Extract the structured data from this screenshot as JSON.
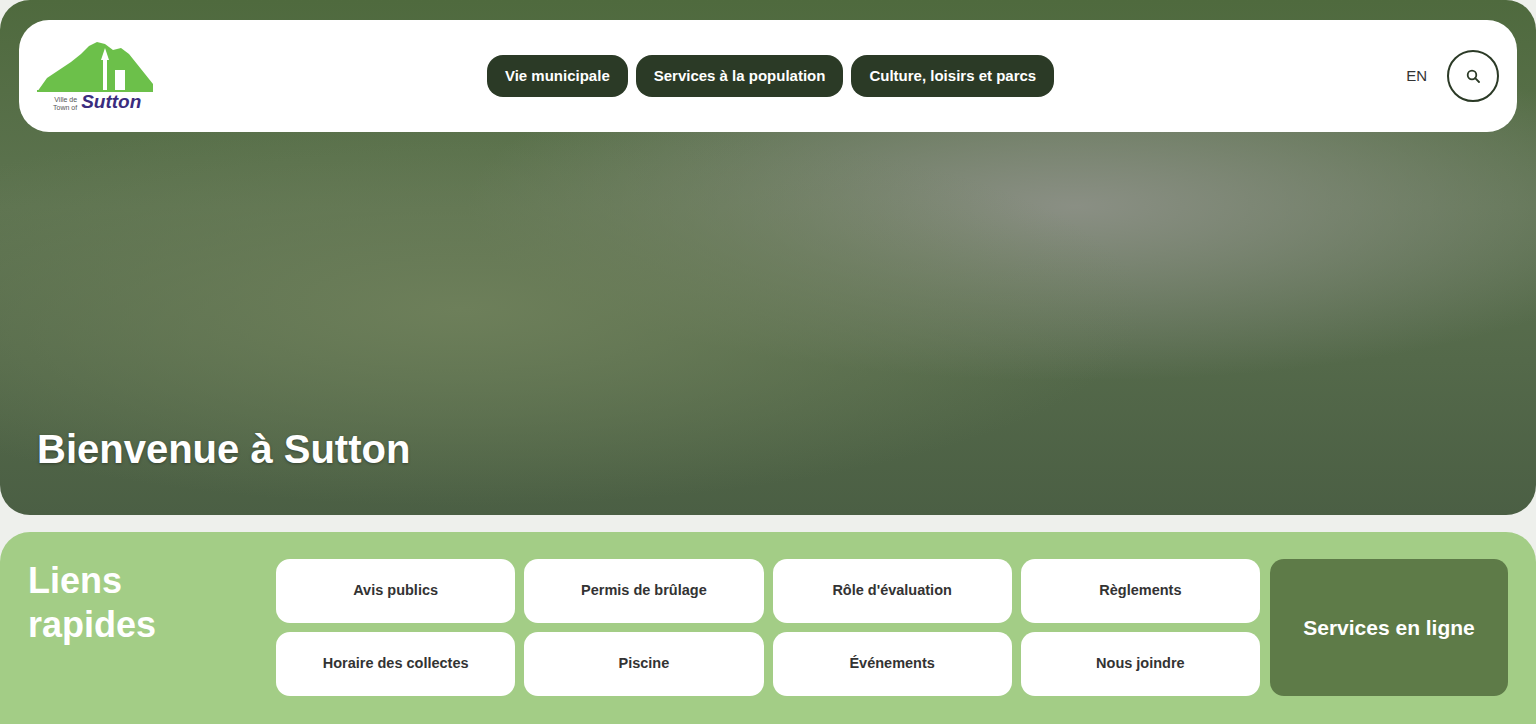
{
  "header": {
    "logo": {
      "line1": "Ville de",
      "line2": "Town of",
      "name": "Sutton"
    },
    "nav": [
      "Vie municipale",
      "Services à la population",
      "Culture, loisirs et parcs"
    ],
    "language": "EN"
  },
  "hero": {
    "title": "Bienvenue à Sutton"
  },
  "quick_links": {
    "title": "Liens rapides",
    "links": [
      "Avis publics",
      "Permis de brûlage",
      "Rôle d'évaluation",
      "Règlements",
      "Horaire des collectes",
      "Piscine",
      "Événements",
      "Nous joindre"
    ],
    "featured": "Services en ligne"
  }
}
